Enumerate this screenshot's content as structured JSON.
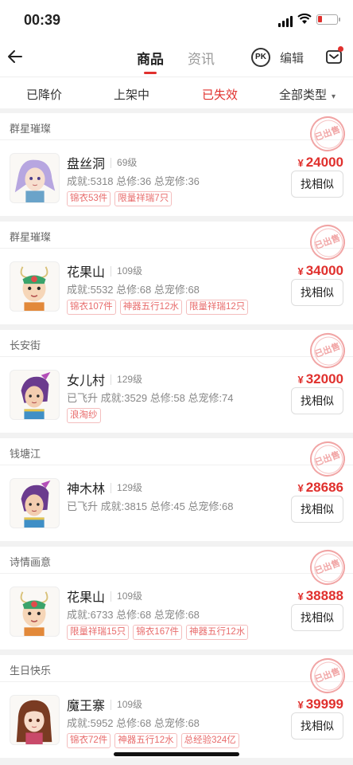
{
  "status_bar": {
    "time": "00:39"
  },
  "nav": {
    "tab_goods": "商品",
    "tab_news": "资讯",
    "pk_label": "PK",
    "edit": "编辑"
  },
  "filters": {
    "reduced": "已降价",
    "listed": "上架中",
    "expired": "已失效",
    "all_types": "全部类型"
  },
  "colors": {
    "accent": "#e0302d",
    "tag_text": "#e86b6b"
  },
  "cards": [
    {
      "header": "群星璀璨",
      "stamp": "已出售",
      "avatar_icon": "character-purple-hair-avatar",
      "server": "盘丝洞",
      "level": "69级",
      "stats": "成就:5318 总修:36 总宠修:36",
      "tags": [
        "锦衣53件",
        "限量祥瑞7只"
      ],
      "currency": "¥",
      "price": "24000",
      "button": "找相似"
    },
    {
      "header": "群星璀璨",
      "stamp": "已出售",
      "avatar_icon": "character-monkey-king-avatar",
      "server": "花果山",
      "level": "109级",
      "stats": "成就:5532 总修:68 总宠修:68",
      "tags": [
        "锦衣107件",
        "神器五行12水",
        "限量祥瑞12只"
      ],
      "currency": "¥",
      "price": "34000",
      "button": "找相似"
    },
    {
      "header": "长安街",
      "stamp": "已出售",
      "avatar_icon": "character-female-warrior-avatar",
      "server": "女儿村",
      "level": "129级",
      "stats": "已飞升 成就:3529 总修:58 总宠修:74",
      "tags": [
        "浪淘纱"
      ],
      "currency": "¥",
      "price": "32000",
      "button": "找相似"
    },
    {
      "header": "钱塘江",
      "stamp": "已出售",
      "avatar_icon": "character-female-warrior-avatar",
      "server": "神木林",
      "level": "129级",
      "stats": "已飞升 成就:3815 总修:45 总宠修:68",
      "tags": [],
      "currency": "¥",
      "price": "28686",
      "button": "找相似"
    },
    {
      "header": "诗情画意",
      "stamp": "已出售",
      "avatar_icon": "character-monkey-king-avatar",
      "server": "花果山",
      "level": "109级",
      "stats": "成就:6733 总修:68 总宠修:68",
      "tags": [
        "限量祥瑞15只",
        "锦衣167件",
        "神器五行12水"
      ],
      "currency": "¥",
      "price": "38888",
      "button": "找相似"
    },
    {
      "header": "生日快乐",
      "stamp": "已出售",
      "avatar_icon": "character-girl-brown-hair-avatar",
      "server": "魔王寨",
      "level": "109级",
      "stats": "成就:5952 总修:68 总宠修:68",
      "tags": [
        "锦衣72件",
        "神器五行12水",
        "总经验324亿"
      ],
      "currency": "¥",
      "price": "39999",
      "button": "找相似"
    }
  ]
}
